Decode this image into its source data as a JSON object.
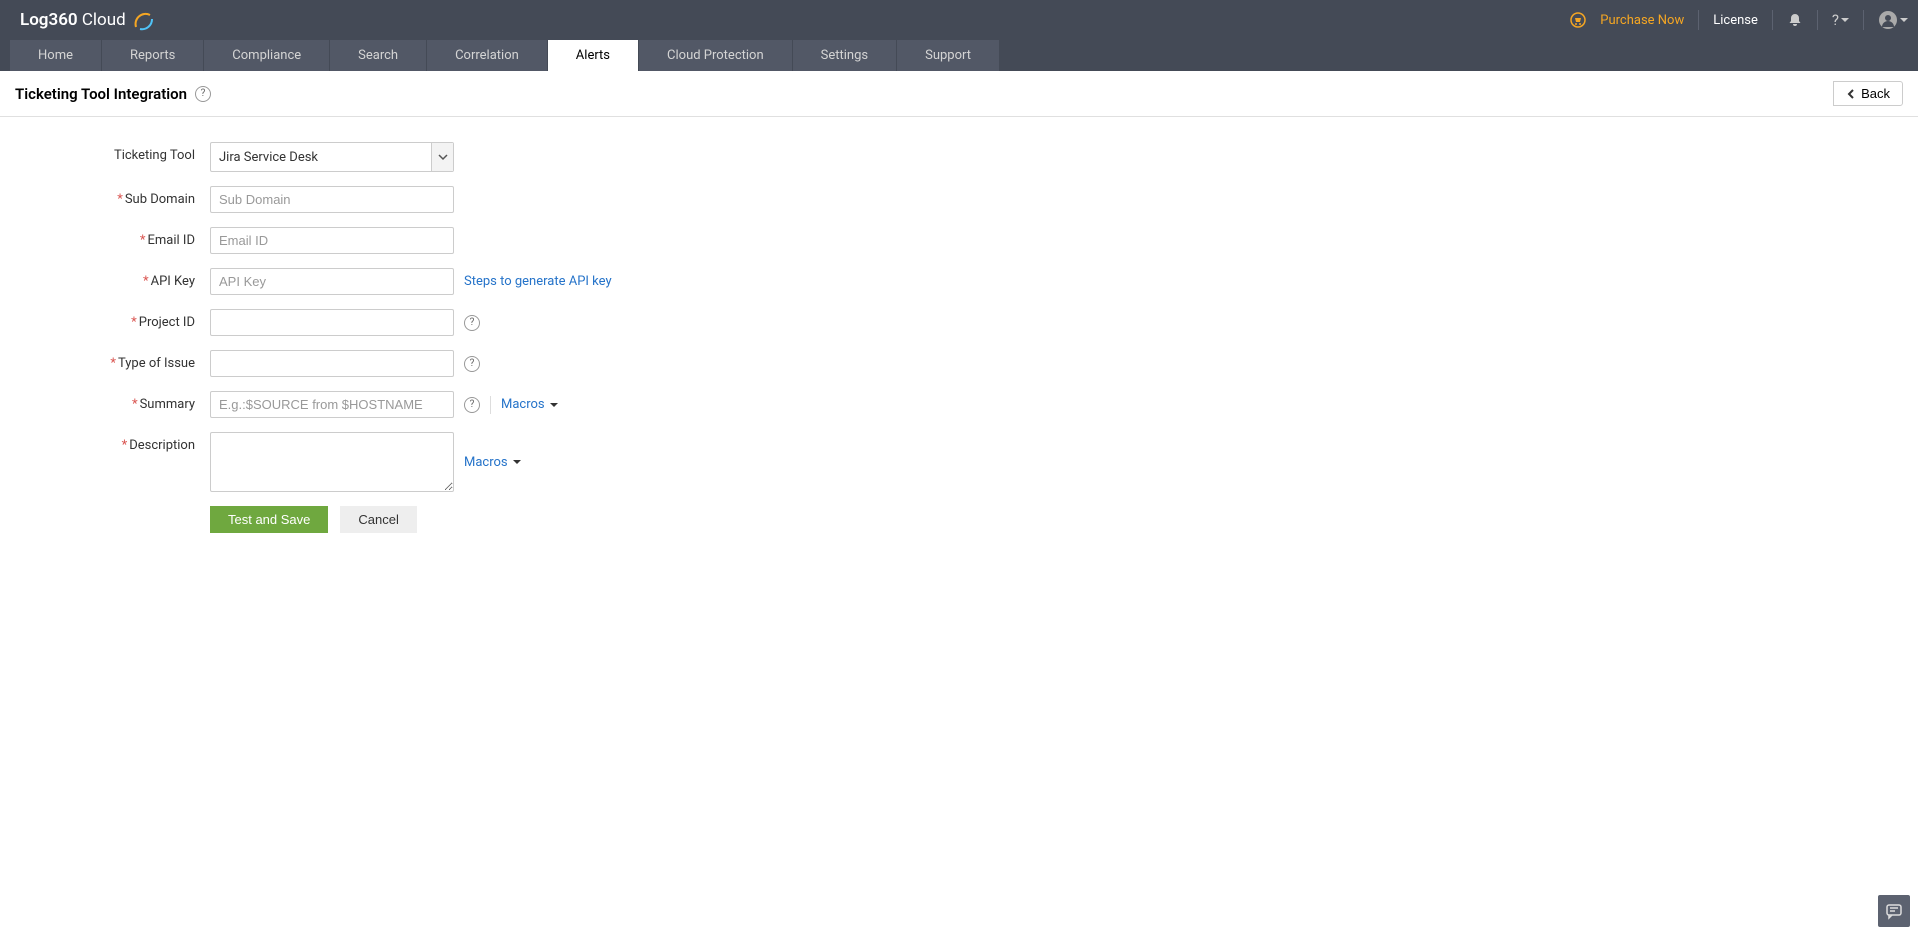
{
  "header": {
    "logo": "Log360 Cloud",
    "purchase": "Purchase Now",
    "license": "License"
  },
  "nav": {
    "tabs": [
      "Home",
      "Reports",
      "Compliance",
      "Search",
      "Correlation",
      "Alerts",
      "Cloud Protection",
      "Settings",
      "Support"
    ],
    "active": "Alerts"
  },
  "page": {
    "title": "Ticketing Tool Integration",
    "back": "Back"
  },
  "form": {
    "ticketing_tool_label": "Ticketing Tool",
    "ticketing_tool_value": "Jira Service Desk",
    "sub_domain_label": "Sub Domain",
    "sub_domain_placeholder": "Sub Domain",
    "email_label": "Email ID",
    "email_placeholder": "Email ID",
    "api_key_label": "API Key",
    "api_key_placeholder": "API Key",
    "api_key_help": "Steps to generate API key",
    "project_id_label": "Project ID",
    "issue_type_label": "Type of Issue",
    "summary_label": "Summary",
    "summary_placeholder": "E.g.:$SOURCE from $HOSTNAME",
    "description_label": "Description",
    "macros": "Macros",
    "test_save": "Test and Save",
    "cancel": "Cancel"
  }
}
